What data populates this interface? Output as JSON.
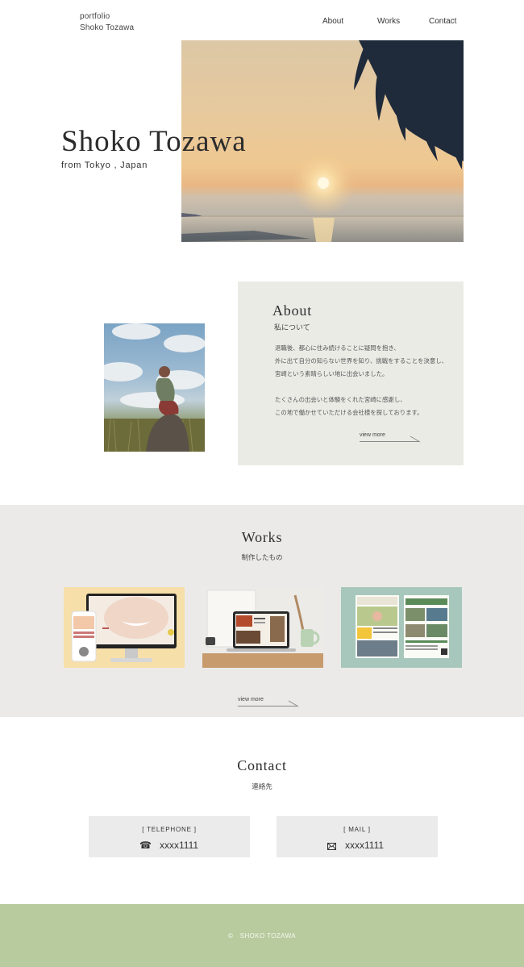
{
  "header": {
    "logo_line1": "portfolio",
    "logo_line2": "Shoko Tozawa",
    "nav": [
      "About",
      "Works",
      "Contact"
    ]
  },
  "hero": {
    "name": "Shoko Tozawa",
    "location": "from Tokyo , Japan"
  },
  "about": {
    "title": "About",
    "subtitle": "私について",
    "paragraph1": [
      "退職後、都心に住み続けることに疑問を抱き、",
      "外に出て自分の知らない世界を知り、挑戦をすることを決意し、",
      "宮崎という素晴らしい地に出会いました。"
    ],
    "paragraph2": [
      "たくさんの出会いと体験をくれた宮崎に感謝し、",
      "この地で働かせていただける会社様を探しております。"
    ],
    "view_more": "view more"
  },
  "works": {
    "title": "Works",
    "subtitle": "制作したもの",
    "view_more": "view more"
  },
  "contact": {
    "title": "Contact",
    "subtitle": "連絡先",
    "telephone_label": "[ TELEPHONE ]",
    "telephone_value": "xxxx1111",
    "mail_label": "[ MAIL ]",
    "mail_value": "xxxx1111"
  },
  "footer": {
    "copyright": "©　SHOKO TOZAWA"
  },
  "colors": {
    "about_box": "#ebebe6",
    "works_band": "#ebeae8",
    "contact_box": "#ebebeb",
    "footer": "#b8cb9f"
  },
  "icons": [
    "phone-icon",
    "mail-icon"
  ]
}
